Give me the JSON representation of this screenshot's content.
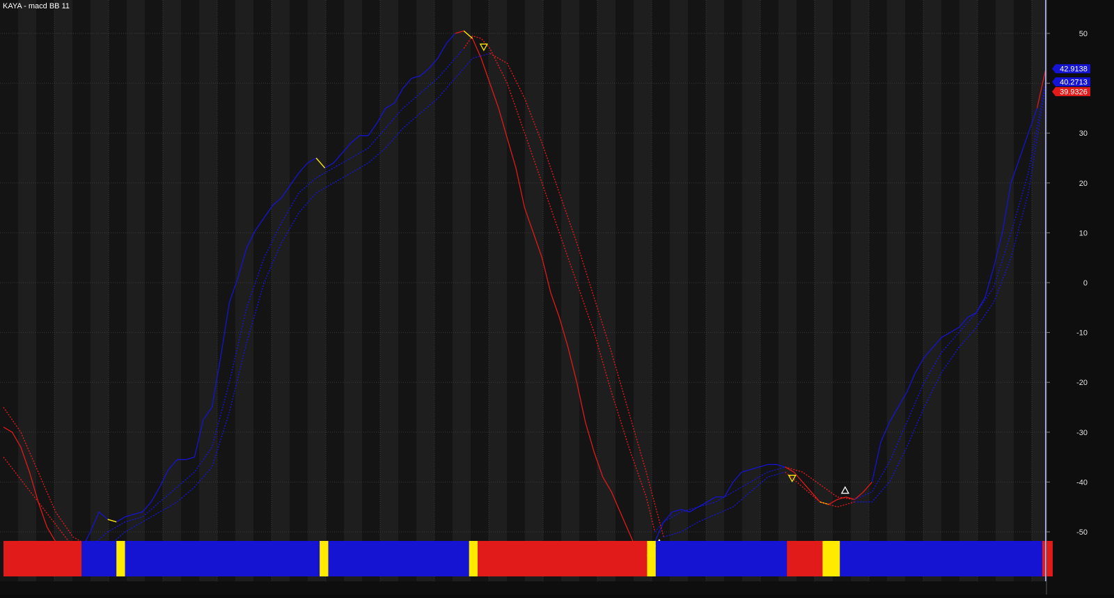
{
  "window": {
    "title": "KAYA - macd BB 11"
  },
  "colors": {
    "background": "#151515",
    "band_dark": "#141414",
    "band_light": "#1e1e1e",
    "grid": "#3a3a3a",
    "up": "#1414d2",
    "down": "#e11a1a",
    "yellow": "#ffea00",
    "cursor": "#aeb4ff",
    "axis_text": "#e6e6e6"
  },
  "chart_data": {
    "type": "line",
    "title": "KAYA - macd BB 11",
    "ylim": [
      -55,
      55
    ],
    "y_ticks": [
      50,
      40,
      30,
      20,
      10,
      0,
      -10,
      -20,
      -30,
      -40,
      -50
    ],
    "x_range": [
      0,
      120
    ],
    "series": [
      {
        "role": "macd",
        "style": "solid",
        "points": [
          [
            0,
            -29
          ],
          [
            1,
            -30
          ],
          [
            2,
            -33
          ],
          [
            3,
            -38
          ],
          [
            4,
            -44
          ],
          [
            5,
            -49
          ],
          [
            6,
            -52
          ],
          [
            7,
            -54
          ],
          [
            8,
            -55
          ],
          [
            9,
            -53.5
          ],
          [
            10,
            -50
          ],
          [
            11,
            -46
          ],
          [
            12,
            -47.5
          ],
          [
            13,
            -48
          ],
          [
            14,
            -47
          ],
          [
            15,
            -46.5
          ],
          [
            16,
            -46
          ],
          [
            17,
            -44
          ],
          [
            18,
            -41
          ],
          [
            19,
            -37.5
          ],
          [
            20,
            -35.5
          ],
          [
            21,
            -35.5
          ],
          [
            22,
            -35
          ],
          [
            23,
            -27.5
          ],
          [
            24,
            -25
          ],
          [
            25,
            -15
          ],
          [
            26,
            -4
          ],
          [
            27,
            1
          ],
          [
            28,
            7
          ],
          [
            29,
            10.5
          ],
          [
            30,
            13
          ],
          [
            31,
            15.5
          ],
          [
            32,
            17
          ],
          [
            33,
            19.5
          ],
          [
            34,
            22
          ],
          [
            35,
            24
          ],
          [
            36,
            25
          ],
          [
            37,
            23
          ],
          [
            38,
            24
          ],
          [
            39,
            26
          ],
          [
            40,
            28
          ],
          [
            41,
            29.5
          ],
          [
            42,
            29.5
          ],
          [
            43,
            32
          ],
          [
            44,
            35
          ],
          [
            45,
            36
          ],
          [
            46,
            39
          ],
          [
            47,
            41
          ],
          [
            48,
            41.5
          ],
          [
            49,
            43
          ],
          [
            50,
            45
          ],
          [
            51,
            48
          ],
          [
            52,
            50
          ],
          [
            53,
            50.5
          ],
          [
            54,
            49
          ],
          [
            55,
            45
          ],
          [
            56,
            40
          ],
          [
            57,
            35
          ],
          [
            58,
            29
          ],
          [
            59,
            23
          ],
          [
            60,
            15
          ],
          [
            61,
            10
          ],
          [
            62,
            5
          ],
          [
            63,
            -2
          ],
          [
            64,
            -7
          ],
          [
            65,
            -13
          ],
          [
            66,
            -20
          ],
          [
            67,
            -28
          ],
          [
            68,
            -34
          ],
          [
            69,
            -39
          ],
          [
            70,
            -42
          ],
          [
            71,
            -46
          ],
          [
            72,
            -50
          ],
          [
            73,
            -54
          ],
          [
            74,
            -55
          ],
          [
            75,
            -52
          ],
          [
            76,
            -48
          ],
          [
            77,
            -46
          ],
          [
            78,
            -45.5
          ],
          [
            79,
            -46
          ],
          [
            80,
            -45
          ],
          [
            81,
            -44
          ],
          [
            82,
            -43
          ],
          [
            83,
            -43
          ],
          [
            84,
            -40
          ],
          [
            85,
            -38
          ],
          [
            86,
            -37.5
          ],
          [
            87,
            -37
          ],
          [
            88,
            -36.5
          ],
          [
            89,
            -36.5
          ],
          [
            90,
            -37
          ],
          [
            91,
            -38
          ],
          [
            92,
            -40
          ],
          [
            93,
            -42
          ],
          [
            94,
            -44
          ],
          [
            95,
            -44.5
          ],
          [
            96,
            -43.5
          ],
          [
            97,
            -43
          ],
          [
            98,
            -43.5
          ],
          [
            99,
            -42
          ],
          [
            100,
            -40
          ],
          [
            101,
            -32
          ],
          [
            102,
            -28
          ],
          [
            103,
            -25
          ],
          [
            104,
            -22
          ],
          [
            105,
            -18
          ],
          [
            106,
            -15
          ],
          [
            107,
            -13
          ],
          [
            108,
            -11
          ],
          [
            109,
            -10
          ],
          [
            110,
            -9
          ],
          [
            111,
            -7
          ],
          [
            112,
            -6
          ],
          [
            113,
            -3
          ],
          [
            114,
            3
          ],
          [
            115,
            10
          ],
          [
            116,
            20
          ],
          [
            117,
            25
          ],
          [
            118,
            30
          ],
          [
            119,
            35
          ],
          [
            120,
            42.9
          ]
        ],
        "segments": [
          {
            "from": 0,
            "to": 9,
            "color": "down"
          },
          {
            "from": 9,
            "to": 52,
            "color": "up"
          },
          {
            "from": 52,
            "to": 74,
            "color": "down"
          },
          {
            "from": 74,
            "to": 90,
            "color": "up"
          },
          {
            "from": 90,
            "to": 100,
            "color": "down"
          },
          {
            "from": 100,
            "to": 119,
            "color": "up"
          },
          {
            "from": 119,
            "to": 120,
            "color": "down"
          }
        ],
        "yellow_ticks": [
          [
            12,
            13
          ],
          [
            36,
            37
          ],
          [
            53,
            54
          ],
          [
            74,
            75
          ],
          [
            94,
            95
          ]
        ]
      },
      {
        "role": "upper_band",
        "style": "dotted",
        "points": [
          [
            0,
            -25
          ],
          [
            2,
            -30
          ],
          [
            4,
            -38
          ],
          [
            6,
            -46
          ],
          [
            8,
            -51
          ],
          [
            10,
            -53
          ],
          [
            12,
            -50
          ],
          [
            14,
            -48
          ],
          [
            16,
            -47
          ],
          [
            18,
            -44
          ],
          [
            20,
            -41
          ],
          [
            22,
            -38
          ],
          [
            24,
            -33
          ],
          [
            26,
            -20
          ],
          [
            28,
            -5
          ],
          [
            30,
            5
          ],
          [
            32,
            12
          ],
          [
            34,
            18
          ],
          [
            36,
            21
          ],
          [
            38,
            23
          ],
          [
            40,
            25
          ],
          [
            42,
            27
          ],
          [
            44,
            31
          ],
          [
            46,
            35
          ],
          [
            48,
            38
          ],
          [
            50,
            41
          ],
          [
            52,
            45
          ],
          [
            53,
            47
          ],
          [
            54,
            49.5
          ],
          [
            55,
            49
          ],
          [
            56,
            47
          ],
          [
            58,
            40
          ],
          [
            60,
            30
          ],
          [
            62,
            20
          ],
          [
            64,
            10
          ],
          [
            66,
            0
          ],
          [
            68,
            -10
          ],
          [
            70,
            -22
          ],
          [
            72,
            -33
          ],
          [
            74,
            -43
          ],
          [
            75,
            -50
          ],
          [
            76,
            -48
          ],
          [
            78,
            -46
          ],
          [
            80,
            -45
          ],
          [
            82,
            -44
          ],
          [
            84,
            -42
          ],
          [
            86,
            -40
          ],
          [
            88,
            -38
          ],
          [
            90,
            -37
          ],
          [
            92,
            -38
          ],
          [
            94,
            -40.5
          ],
          [
            96,
            -43
          ],
          [
            98,
            -43.5
          ],
          [
            100,
            -42
          ],
          [
            102,
            -36
          ],
          [
            104,
            -28
          ],
          [
            106,
            -20
          ],
          [
            108,
            -14
          ],
          [
            110,
            -10
          ],
          [
            112,
            -6
          ],
          [
            114,
            -1
          ],
          [
            116,
            10
          ],
          [
            118,
            22
          ],
          [
            120,
            40.27
          ]
        ],
        "segments": [
          {
            "from": 0,
            "to": 10,
            "color": "down"
          },
          {
            "from": 10,
            "to": 53,
            "color": "up"
          },
          {
            "from": 53,
            "to": 75,
            "color": "down"
          },
          {
            "from": 75,
            "to": 90,
            "color": "up"
          },
          {
            "from": 90,
            "to": 98,
            "color": "down"
          },
          {
            "from": 98,
            "to": 120,
            "color": "up"
          }
        ]
      },
      {
        "role": "lower_band",
        "style": "dotted",
        "points": [
          [
            0,
            -35
          ],
          [
            4,
            -44
          ],
          [
            8,
            -53
          ],
          [
            10,
            -55
          ],
          [
            12,
            -53
          ],
          [
            14,
            -50
          ],
          [
            16,
            -48
          ],
          [
            18,
            -46
          ],
          [
            20,
            -44
          ],
          [
            22,
            -41
          ],
          [
            24,
            -37
          ],
          [
            26,
            -26
          ],
          [
            28,
            -12
          ],
          [
            30,
            0
          ],
          [
            32,
            8
          ],
          [
            34,
            14
          ],
          [
            36,
            18
          ],
          [
            38,
            20
          ],
          [
            40,
            22
          ],
          [
            42,
            24
          ],
          [
            44,
            27
          ],
          [
            46,
            31
          ],
          [
            48,
            34
          ],
          [
            50,
            37
          ],
          [
            52,
            41
          ],
          [
            54,
            45
          ],
          [
            56,
            46
          ],
          [
            58,
            44
          ],
          [
            60,
            37
          ],
          [
            62,
            28
          ],
          [
            64,
            18
          ],
          [
            66,
            8
          ],
          [
            68,
            -3
          ],
          [
            70,
            -14
          ],
          [
            72,
            -26
          ],
          [
            74,
            -38
          ],
          [
            76,
            -51
          ],
          [
            78,
            -50
          ],
          [
            80,
            -48
          ],
          [
            82,
            -46.5
          ],
          [
            84,
            -45
          ],
          [
            86,
            -42
          ],
          [
            88,
            -39
          ],
          [
            90,
            -38
          ],
          [
            92,
            -41
          ],
          [
            94,
            -44
          ],
          [
            96,
            -45
          ],
          [
            98,
            -44
          ],
          [
            100,
            -44
          ],
          [
            102,
            -40
          ],
          [
            104,
            -33
          ],
          [
            106,
            -25
          ],
          [
            108,
            -18
          ],
          [
            110,
            -13
          ],
          [
            112,
            -9
          ],
          [
            114,
            -4
          ],
          [
            116,
            5
          ],
          [
            118,
            18
          ],
          [
            120,
            39.93
          ]
        ],
        "segments": [
          {
            "from": 0,
            "to": 10,
            "color": "down"
          },
          {
            "from": 10,
            "to": 56,
            "color": "up"
          },
          {
            "from": 56,
            "to": 76,
            "color": "down"
          },
          {
            "from": 76,
            "to": 90,
            "color": "up"
          },
          {
            "from": 90,
            "to": 98,
            "color": "down"
          },
          {
            "from": 98,
            "to": 120,
            "color": "up"
          }
        ]
      }
    ],
    "markers": [
      {
        "x": 9.5,
        "y": -54.8,
        "dir": "up"
      },
      {
        "x": 55.3,
        "y": 47.3,
        "dir": "down"
      },
      {
        "x": 75.5,
        "y": -52.3,
        "dir": "up"
      },
      {
        "x": 90.8,
        "y": -39.2,
        "dir": "down"
      },
      {
        "x": 96.9,
        "y": -41.7,
        "dir": "up"
      }
    ],
    "ribbon": [
      {
        "from": 0,
        "to": 9,
        "color": "down"
      },
      {
        "from": 9,
        "to": 13,
        "color": "up"
      },
      {
        "from": 13,
        "to": 14,
        "color": "yellow"
      },
      {
        "from": 14,
        "to": 36.4,
        "color": "up"
      },
      {
        "from": 36.4,
        "to": 37.4,
        "color": "yellow"
      },
      {
        "from": 37.4,
        "to": 53.6,
        "color": "up"
      },
      {
        "from": 53.6,
        "to": 54.6,
        "color": "yellow"
      },
      {
        "from": 54.6,
        "to": 74.1,
        "color": "down"
      },
      {
        "from": 74.1,
        "to": 75.1,
        "color": "yellow"
      },
      {
        "from": 75.1,
        "to": 90.2,
        "color": "up"
      },
      {
        "from": 90.2,
        "to": 94.3,
        "color": "down"
      },
      {
        "from": 94.3,
        "to": 96.3,
        "color": "yellow"
      },
      {
        "from": 96.3,
        "to": 119.6,
        "color": "up"
      },
      {
        "from": 119.6,
        "to": 120.8,
        "color": "down"
      }
    ],
    "cursor_x": 120,
    "value_labels": [
      {
        "text": "42.9138",
        "y": 42.9138,
        "color": "up"
      },
      {
        "text": "40.2713",
        "y": 40.2713,
        "color": "up"
      },
      {
        "text": "39.9326",
        "y": 39.9326,
        "color": "down"
      }
    ],
    "grid": true
  }
}
